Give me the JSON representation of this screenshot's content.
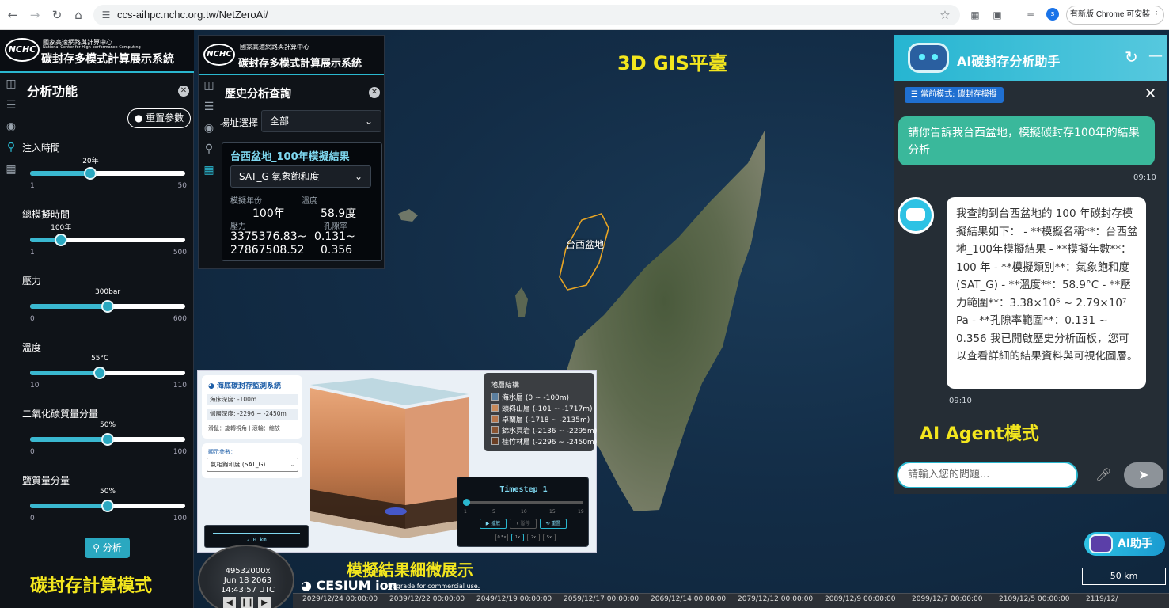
{
  "browser": {
    "url": "ccs-aihpc.nchc.org.tw/NetZeroAi/",
    "update_label": "有新版 Chrome 可安裝",
    "avatar_letter": "s"
  },
  "branding": {
    "logo_text": "NCHC",
    "org_name": "國家高速網路與計算中心",
    "org_name_en": "National Center for High-performance Computing",
    "system_name": "碳封存多模式計算展示系統"
  },
  "left_panel": {
    "title": "分析功能",
    "reset_label": "重置參數",
    "analyze_label": "分析",
    "params": [
      {
        "label": "注入時間",
        "value_label": "20年",
        "min": "1",
        "max": "50",
        "fraction": 0.39
      },
      {
        "label": "總模擬時間",
        "value_label": "100年",
        "min": "1",
        "max": "500",
        "fraction": 0.2
      },
      {
        "label": "壓力",
        "value_label": "300bar",
        "min": "0",
        "max": "600",
        "fraction": 0.5
      },
      {
        "label": "溫度",
        "value_label": "55°C",
        "min": "10",
        "max": "110",
        "fraction": 0.45
      },
      {
        "label": "二氧化碳質量分量",
        "value_label": "50%",
        "min": "0",
        "max": "100",
        "fraction": 0.5
      },
      {
        "label": "鹽質量分量",
        "value_label": "50%",
        "min": "0",
        "max": "100",
        "fraction": 0.5
      }
    ]
  },
  "history_panel": {
    "title": "歷史分析查詢",
    "site_label": "場址選擇",
    "site_value": "全部",
    "result_title": "台西盆地_100年模擬結果",
    "variable": "SAT_G 氣象飽和度",
    "sim_year_label": "模擬年份",
    "sim_year_value": "100年",
    "temp_label": "溫度",
    "temp_value": "58.9度",
    "pressure_label": "壓力",
    "pressure_value_1": "3375376.83~",
    "pressure_value_2": "27867508.52",
    "porosity_label": "孔隙率",
    "porosity_value_1": "0.131~",
    "porosity_value_2": "0.356"
  },
  "map": {
    "title": "3D GIS平臺",
    "basin_label": "台西盆地",
    "scale_label": "50 km"
  },
  "sim_window": {
    "title": "海底碳封存監測系統",
    "seafloor_depth": "海床深度: -100m",
    "storage_depth": "儲層深度: -2296 ~ -2450m",
    "controls_hint": "滑鼠：旋轉視角 | 滾輪：縮放",
    "display_param_label": "顯示參數：",
    "display_param_value": "氣相飽和度 (SAT_G)",
    "legend_title": "地層結構",
    "legend": [
      {
        "label": "海水層 (0 ~ -100m)",
        "color": "#5b7fa0"
      },
      {
        "label": "頭嵙山層 (-101 ~ -1717m)",
        "color": "#c98a5a"
      },
      {
        "label": "卓蘭層 (-1718 ~ -2135m)",
        "color": "#b6754a"
      },
      {
        "label": "錦水頁岩 (-2136 ~ -2295m)",
        "color": "#8a5432"
      },
      {
        "label": "桂竹林層 (-2296 ~ -2450m)",
        "color": "#6b3f24"
      }
    ],
    "timestep_label": "Timestep 1",
    "timestep_ticks": [
      "1",
      "5",
      "10",
      "15",
      "19"
    ],
    "play_label": "▶ 播放",
    "pause_label": "⏸ 暫停",
    "reset_label": "⟲ 重置",
    "speeds": [
      "0.5x",
      "1x",
      "2x",
      "5x"
    ],
    "scale_label": "2.0 km",
    "caption": "模擬結果細微展示"
  },
  "ai_panel": {
    "title": "AI碳封存分析助手",
    "mode_badge": "當前模式: 碳封存模擬",
    "user_message": "請你告訴我台西盆地，模擬碳封存100年的結果分析",
    "user_time": "09:10",
    "bot_message": "我查詢到台西盆地的 100 年碳封存模擬結果如下： - **模擬名稱**：台西盆地_100年模擬結果 - **模擬年數**：100 年 - **模擬類別**：氣象飽和度 (SAT_G) - **溫度**：58.9°C - **壓力範圍**：3.38×10⁶ ~ 2.79×10⁷ Pa - **孔隙率範圍**：0.131 ~ 0.356 我已開啟歷史分析面板，您可以查看詳細的結果資料與可視化圖層。",
    "bot_time": "09:10",
    "input_placeholder": "請輸入您的問題...",
    "caption": "AI Agent模式",
    "launcher_label": "AI助手"
  },
  "captions": {
    "left": "碳封存計算模式"
  },
  "clock": {
    "speed": "49532000x",
    "date": "Jun 18 2063",
    "time": "14:43:57 UTC"
  },
  "cesium": {
    "logo": "CESIUM ion",
    "upgrade": "Upgrade for commercial use."
  },
  "timeline_ticks": [
    "2029/12/24 00:00:00",
    "2039/12/22 00:00:00",
    "2049/12/19 00:00:00",
    "2059/12/17 00:00:00",
    "2069/12/14 00:00:00",
    "2079/12/12 00:00:00",
    "2089/12/9 00:00:00",
    "2099/12/7 00:00:00",
    "2109/12/5 00:00:00",
    "2119/12/"
  ]
}
